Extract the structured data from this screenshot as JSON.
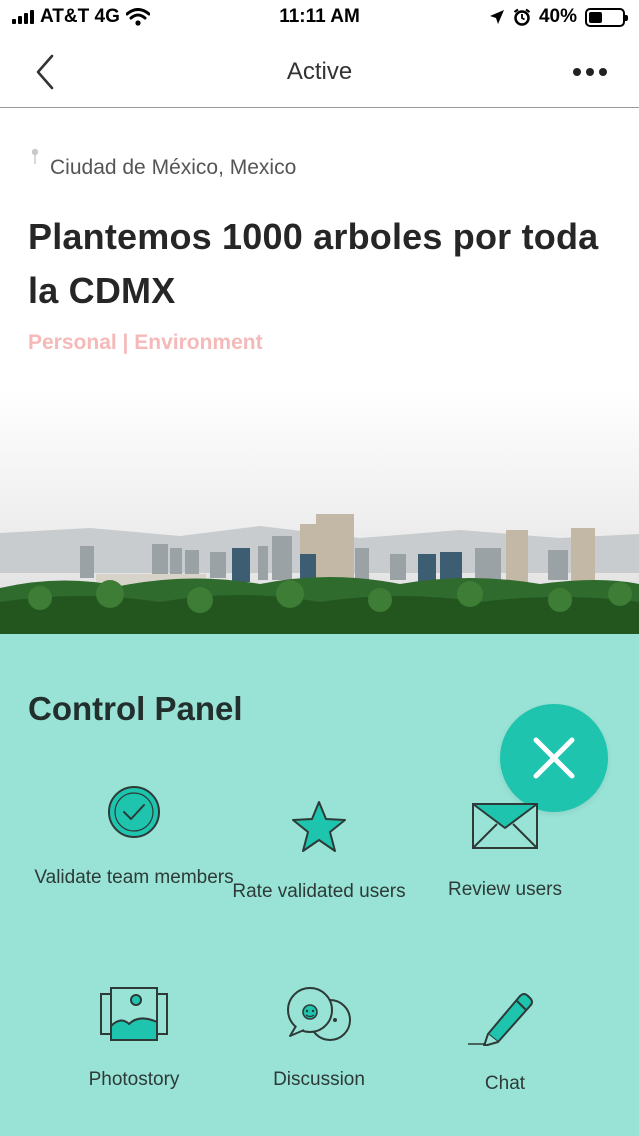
{
  "status_bar": {
    "carrier": "AT&T 4G",
    "time": "11:11 AM",
    "battery": "40%",
    "battery_level": 0.4
  },
  "nav": {
    "title": "Active",
    "back_icon": "chevron-left-icon",
    "more_icon": "ellipsis-icon"
  },
  "project": {
    "location": "Ciudad de México, Mexico",
    "title": "Plantemos 1000 arboles por toda la CDMX",
    "tags": "Personal | Environment"
  },
  "control_panel": {
    "title": "Control Panel",
    "close_icon": "close-icon",
    "items": [
      {
        "label": "Validate team members",
        "icon": "check-circle-icon"
      },
      {
        "label": "Rate validated users",
        "icon": "star-icon"
      },
      {
        "label": "Review users",
        "icon": "envelope-icon"
      },
      {
        "label": "Photostory",
        "icon": "photo-icon"
      },
      {
        "label": "Discussion",
        "icon": "chat-bubbles-icon"
      },
      {
        "label": "Chat",
        "icon": "pencil-icon"
      }
    ]
  },
  "colors": {
    "panel_bg": "#98e3d6",
    "accent": "#1ec4ad",
    "tag_text": "#f6b9b9"
  }
}
